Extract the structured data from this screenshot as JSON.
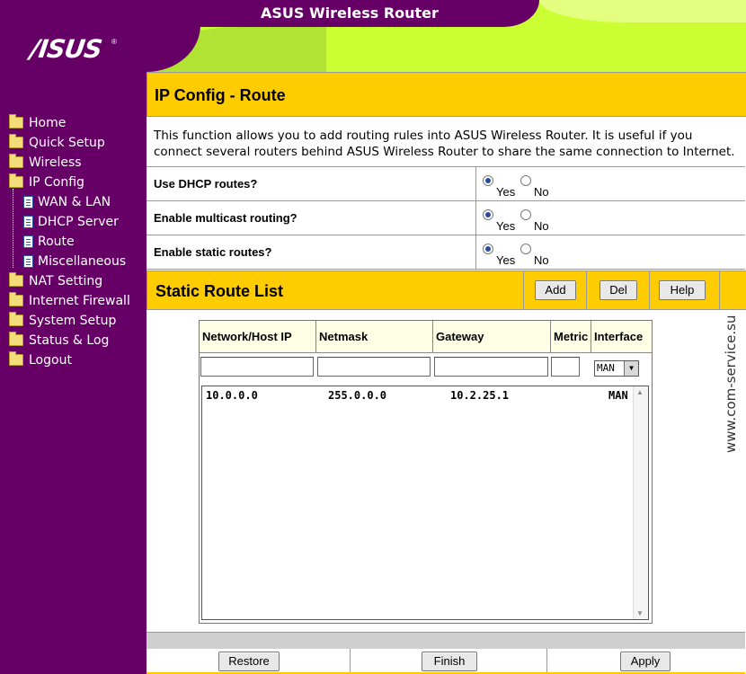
{
  "header": {
    "title": "ASUS Wireless Router",
    "logo": "/ISUS",
    "logo_mark": "®"
  },
  "nav": {
    "items": [
      {
        "label": "Home",
        "icon": "folder-icon"
      },
      {
        "label": "Quick Setup",
        "icon": "folder-icon"
      },
      {
        "label": "Wireless",
        "icon": "folder-icon"
      },
      {
        "label": "IP Config",
        "icon": "open-folder-icon"
      },
      {
        "label": "WAN & LAN",
        "icon": "page-icon"
      },
      {
        "label": "DHCP Server",
        "icon": "page-icon"
      },
      {
        "label": "Route",
        "icon": "page-icon"
      },
      {
        "label": "Miscellaneous",
        "icon": "page-icon"
      },
      {
        "label": "NAT Setting",
        "icon": "folder-icon"
      },
      {
        "label": "Internet Firewall",
        "icon": "folder-icon"
      },
      {
        "label": "System Setup",
        "icon": "folder-icon"
      },
      {
        "label": "Status & Log",
        "icon": "folder-icon"
      },
      {
        "label": "Logout",
        "icon": "folder-icon"
      }
    ]
  },
  "main": {
    "title": "IP Config - Route",
    "description": "This function allows you to add routing rules into ASUS Wireless Router. It is useful if you connect several routers behind ASUS Wireless Router to share the same connection to Internet.",
    "options": [
      {
        "label": "Use DHCP routes?",
        "yes": "Yes",
        "no": "No",
        "selected": "Yes"
      },
      {
        "label": "Enable multicast routing?",
        "yes": "Yes",
        "no": "No",
        "selected": "Yes"
      },
      {
        "label": "Enable static routes?",
        "yes": "Yes",
        "no": "No",
        "selected": "Yes"
      }
    ],
    "static_route": {
      "title": "Static Route List",
      "add": "Add",
      "del": "Del",
      "help": "Help",
      "columns": [
        "Network/Host IP",
        "Netmask",
        "Gateway",
        "Metric",
        "Interface"
      ],
      "inputs": {
        "network": "",
        "netmask": "",
        "gateway": "",
        "metric": ""
      },
      "interface_selected": "MAN",
      "rows": [
        {
          "network": "10.0.0.0",
          "netmask": "255.0.0.0",
          "gateway": "10.2.25.1",
          "metric": "",
          "interface": "MAN"
        }
      ]
    },
    "buttons": {
      "restore": "Restore",
      "finish": "Finish",
      "apply": "Apply"
    }
  },
  "watermark": "www.com-service.su",
  "colors": {
    "purple": "#660066",
    "lime": "#ccff33",
    "yellow": "#ffcc00"
  }
}
